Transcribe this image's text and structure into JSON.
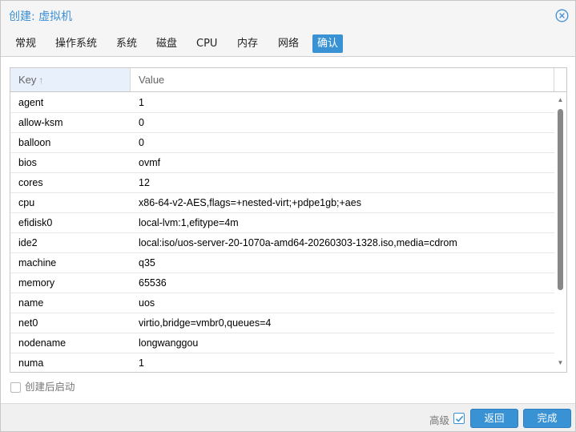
{
  "dialog": {
    "title": "创建: 虚拟机"
  },
  "tabs": [
    {
      "label": "常规"
    },
    {
      "label": "操作系统"
    },
    {
      "label": "系统"
    },
    {
      "label": "磁盘"
    },
    {
      "label": "CPU"
    },
    {
      "label": "内存"
    },
    {
      "label": "网络"
    },
    {
      "label": "确认"
    }
  ],
  "active_tab": "确认",
  "grid": {
    "columns": {
      "key": "Key",
      "value": "Value"
    },
    "sort_indicator": "↑",
    "rows": [
      {
        "key": "agent",
        "value": "1"
      },
      {
        "key": "allow-ksm",
        "value": "0"
      },
      {
        "key": "balloon",
        "value": "0"
      },
      {
        "key": "bios",
        "value": "ovmf"
      },
      {
        "key": "cores",
        "value": "12"
      },
      {
        "key": "cpu",
        "value": "x86-64-v2-AES,flags=+nested-virt;+pdpe1gb;+aes"
      },
      {
        "key": "efidisk0",
        "value": "local-lvm:1,efitype=4m"
      },
      {
        "key": "ide2",
        "value": "local:iso/uos-server-20-1070a-amd64-20260303-1328.iso,media=cdrom"
      },
      {
        "key": "machine",
        "value": "q35"
      },
      {
        "key": "memory",
        "value": "65536"
      },
      {
        "key": "name",
        "value": "uos"
      },
      {
        "key": "net0",
        "value": "virtio,bridge=vmbr0,queues=4"
      },
      {
        "key": "nodename",
        "value": "longwanggou"
      },
      {
        "key": "numa",
        "value": "1"
      }
    ]
  },
  "start_after_created": {
    "label": "创建后启动",
    "checked": false
  },
  "footer": {
    "advanced_label": "高级",
    "advanced_checked": true,
    "back_label": "返回",
    "finish_label": "完成"
  },
  "colors": {
    "accent": "#3892d4",
    "title": "#3b8fd6"
  }
}
